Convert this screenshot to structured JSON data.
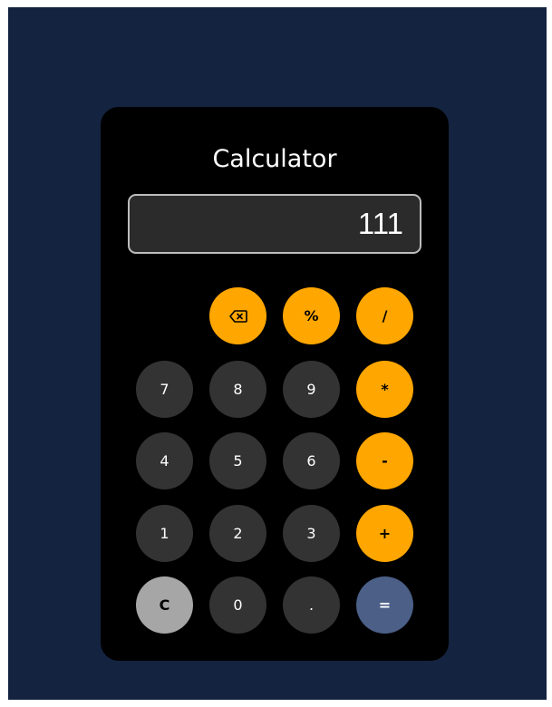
{
  "app": {
    "title": "Calculator"
  },
  "display": {
    "value": "111"
  },
  "buttons": {
    "backspace": "⌫",
    "percent": "%",
    "divide": "/",
    "seven": "7",
    "eight": "8",
    "nine": "9",
    "multiply": "*",
    "four": "4",
    "five": "5",
    "six": "6",
    "subtract": "-",
    "one": "1",
    "two": "2",
    "three": "3",
    "add": "+",
    "clear": "C",
    "zero": "0",
    "decimal": ".",
    "equals": "="
  },
  "colors": {
    "page_background": "#14233f",
    "calculator_body": "#000000",
    "number_button": "#333333",
    "operator_button": "#ffa600",
    "clear_button": "#a6a6a6",
    "equals_button": "#4b5f87",
    "display_background": "#2b2b2b",
    "display_border": "#bdbdbd"
  },
  "icons": {
    "backspace": "backspace-icon"
  }
}
